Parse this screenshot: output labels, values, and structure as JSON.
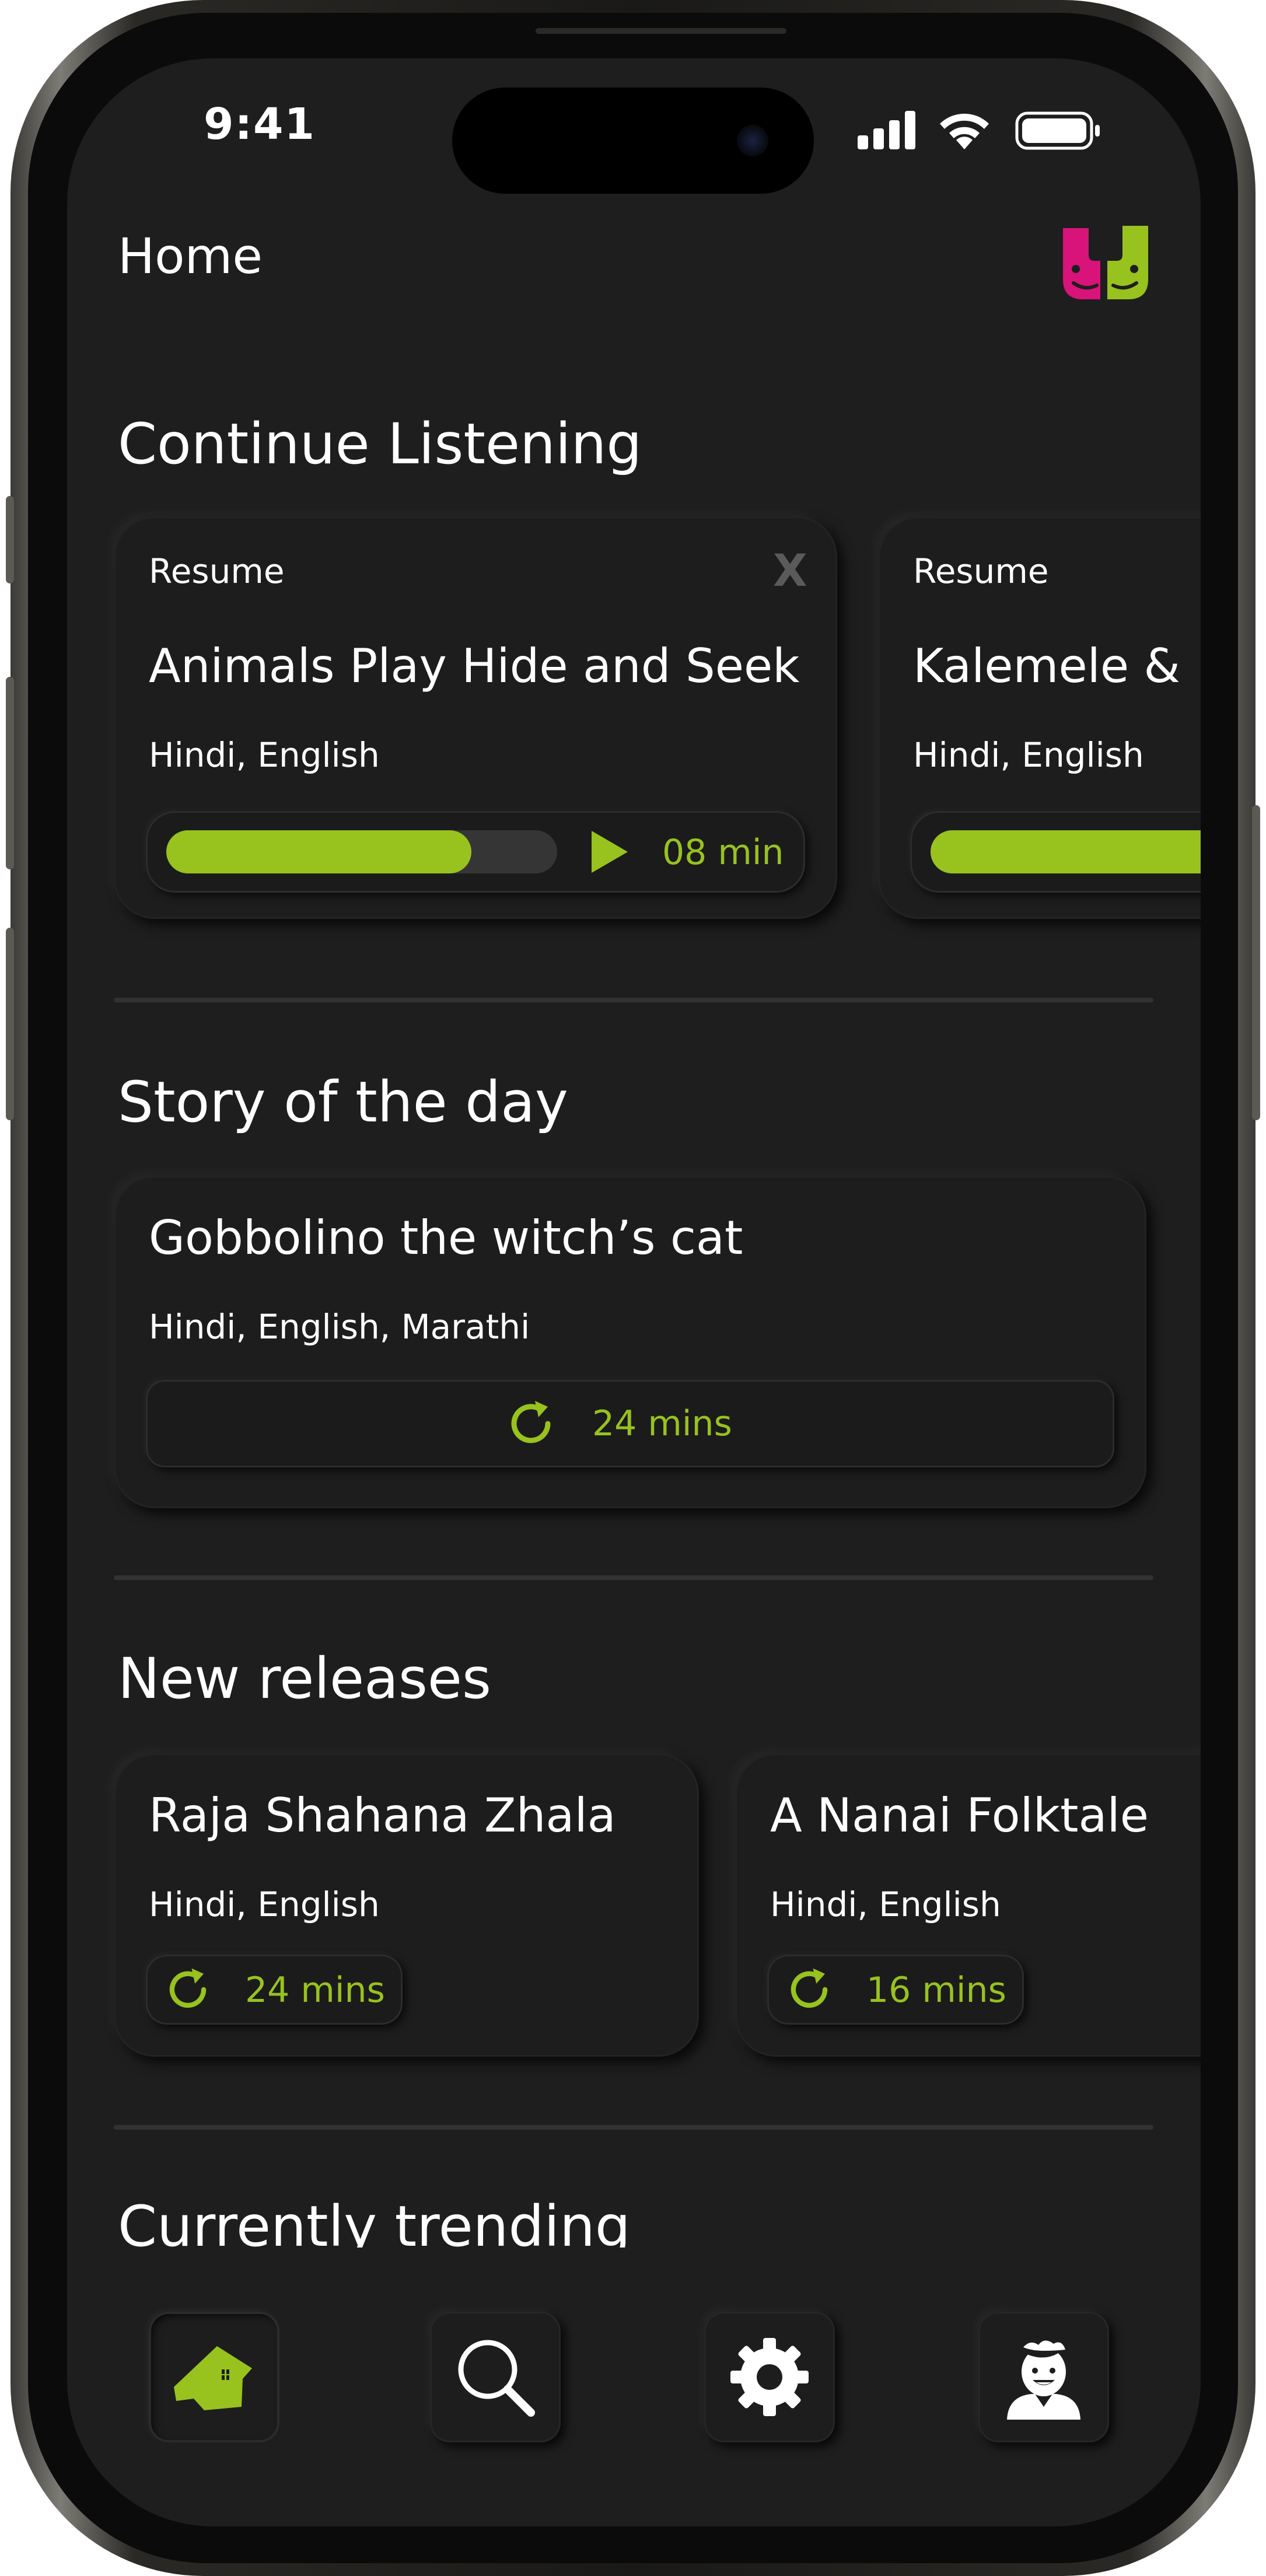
{
  "status_bar": {
    "time": "9:41"
  },
  "header": {
    "title": "Home",
    "logo_icon": "smiley-logo-icon"
  },
  "colors": {
    "accent": "#98c21e",
    "logo_pink": "#d8137a",
    "background": "#1e1e1e"
  },
  "continue_listening": {
    "title": "Continue Listening",
    "cards": [
      {
        "label": "Resume",
        "title": "Animals Play Hide and Seek",
        "languages": "Hindi, English",
        "progress": 0.78,
        "duration": "08 min",
        "close_label": "X"
      },
      {
        "label": "Resume",
        "title": "Kalemele &",
        "languages": "Hindi, English",
        "progress": 0.85
      }
    ]
  },
  "story_of_the_day": {
    "title": "Story of the day",
    "card": {
      "title": "Gobbolino the witch’s cat",
      "languages": "Hindi, English, Marathi",
      "duration": "24 mins"
    }
  },
  "new_releases": {
    "title": "New releases",
    "cards": [
      {
        "title": "Raja Shahana Zhala",
        "languages": "Hindi, English",
        "duration": "24 mins"
      },
      {
        "title": "A Nanai Folktale",
        "languages": "Hindi, English",
        "duration": "16 mins"
      }
    ]
  },
  "currently_trending": {
    "title": "Currently trending"
  },
  "bottom_nav": [
    {
      "icon": "home-icon",
      "active": true
    },
    {
      "icon": "search-icon",
      "active": false
    },
    {
      "icon": "gear-icon",
      "active": false
    },
    {
      "icon": "avatar-icon",
      "active": false
    }
  ]
}
